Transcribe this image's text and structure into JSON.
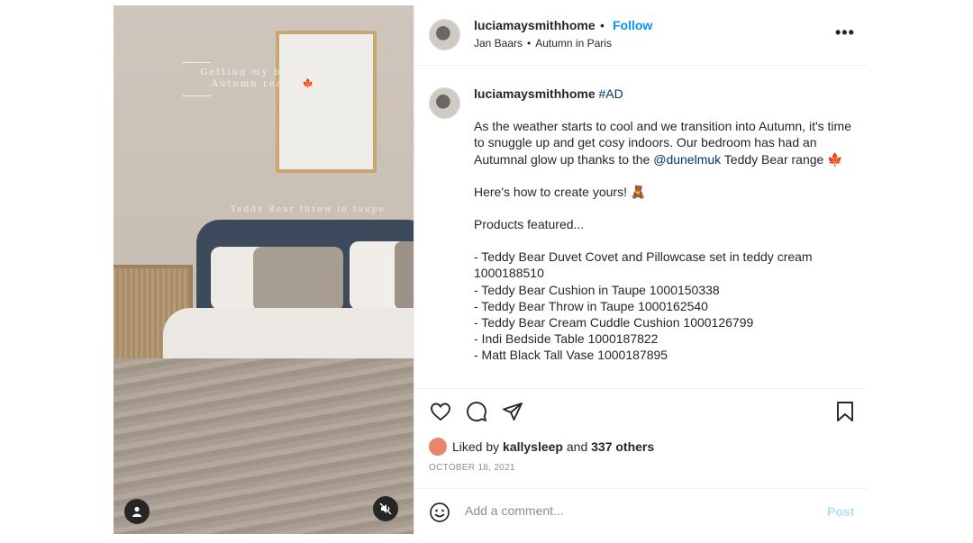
{
  "media": {
    "story_title_line1": "Getting my bedroom",
    "story_title_line2": "Autumn ready 🍁",
    "story_caption": "Teddy Bear throw in taupe",
    "user_tag_icon": "user-icon",
    "mute_icon": "speaker-muted-icon"
  },
  "header": {
    "username": "luciamaysmithhome",
    "separator": "•",
    "follow_label": "Follow",
    "audio_artist": "Jan Baars",
    "audio_dot": "•",
    "audio_track": "Autumn in Paris",
    "more_label": "•••"
  },
  "caption": {
    "username": "luciamaysmithhome",
    "hashtag": "#AD",
    "para1_before": "As the weather starts to cool and we transition into Autumn, it's time to snuggle up and get cosy indoors. Our bedroom has had an Autumnal glow up thanks to the ",
    "mention": "@dunelmuk",
    "para1_after": " Teddy Bear range 🍁",
    "para2": "Here's how to create yours! 🧸",
    "para3": "Products featured...",
    "products": [
      "- Teddy Bear Duvet Covet and Pillowcase set in teddy cream 1000188510",
      "- Teddy Bear Cushion in Taupe 1000150338",
      "- Teddy Bear Throw in Taupe 1000162540",
      "- Teddy Bear Cream Cuddle Cushion 1000126799",
      "- Indi Bedside Table 1000187822",
      "- Matt Black Tall Vase 1000187895"
    ]
  },
  "actions": {
    "like_icon": "heart-icon",
    "comment_icon": "comment-icon",
    "share_icon": "share-icon",
    "save_icon": "bookmark-icon"
  },
  "likes": {
    "prefix": "Liked by ",
    "liker": "kallysleep",
    "middle": " and ",
    "others": "337 others"
  },
  "date": "OCTOBER 18, 2021",
  "comment": {
    "placeholder": "Add a comment...",
    "post_label": "Post"
  },
  "colors": {
    "accent": "#0095f6",
    "link": "#00376b",
    "post_disabled": "#b2dffc",
    "muted": "#8e8e8e"
  }
}
